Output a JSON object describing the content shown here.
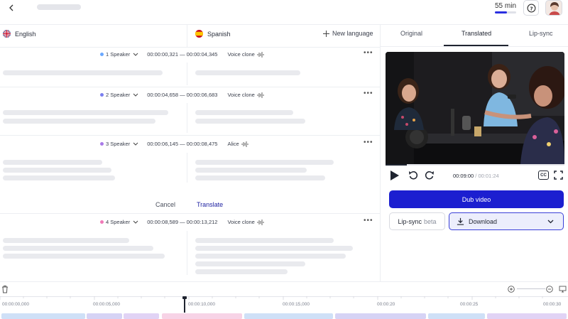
{
  "header": {
    "duration": "55 min"
  },
  "languages": {
    "source": "English",
    "target": "Spanish",
    "add_label": "New language"
  },
  "segments": [
    {
      "speaker": "1 Speaker",
      "color": "#6aa8ff",
      "time": "00:00:00,321 — 00:00:04,345",
      "voice": "Voice clone"
    },
    {
      "speaker": "2 Speaker",
      "color": "#7a7ff0",
      "time": "00:00:04,658 — 00:00:06,683",
      "voice": "Voice clone"
    },
    {
      "speaker": "3 Speaker",
      "color": "#a97ae8",
      "time": "00:00:06,145 — 00:00:08,475",
      "voice": "Alice"
    },
    {
      "speaker": "4 Speaker",
      "color": "#f07ab8",
      "time": "00:00:08,589 — 00:00:13,212",
      "voice": "Voice clone"
    }
  ],
  "edit_actions": {
    "cancel": "Cancel",
    "translate": "Translate"
  },
  "tabs": [
    "Original",
    "Translated",
    "Lip-sync"
  ],
  "active_tab": "Translated",
  "player": {
    "current_time": "00:09:00",
    "total_time": "/ 00:01:24",
    "cc_label": "CC"
  },
  "actions": {
    "dub": "Dub video",
    "lipsync": "Lip-sync",
    "lipsync_badge": "beta",
    "download": "Download"
  },
  "timeline": {
    "labels": [
      "00:00:00,000",
      "00:00:05,000",
      "00:00:10,000",
      "00:00:15,000",
      "00:00:20",
      "00:00:25",
      "00:00:30"
    ]
  },
  "colors": {
    "accent": "#1c1fd0",
    "progress": "#2a2fe0"
  }
}
